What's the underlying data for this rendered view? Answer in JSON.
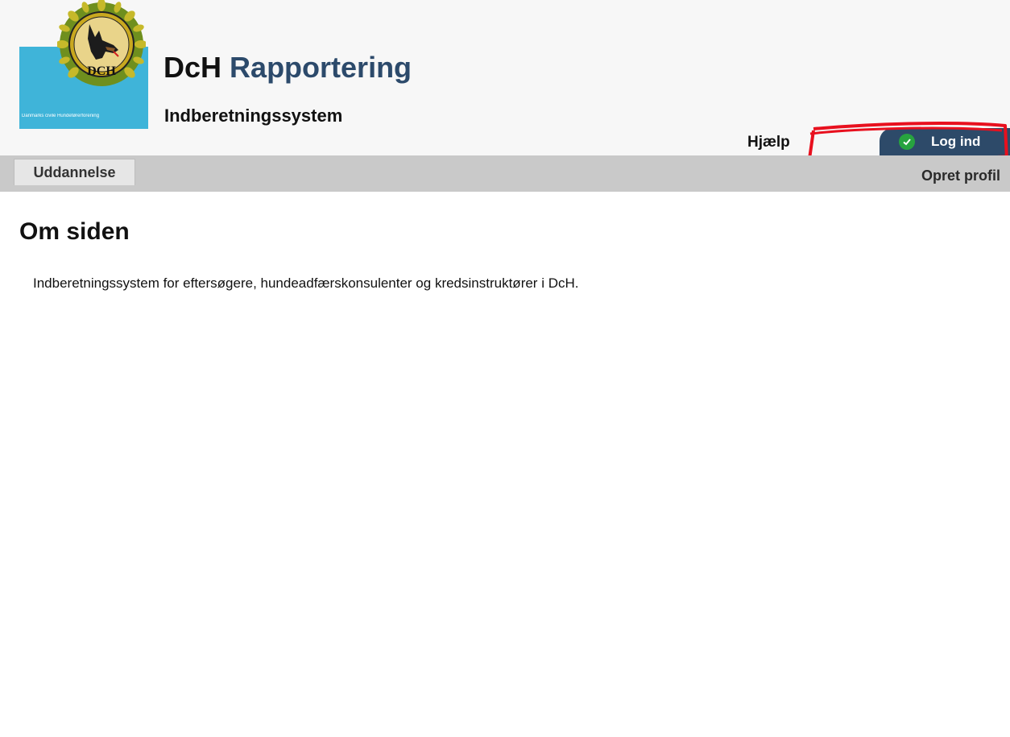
{
  "header": {
    "logo": {
      "icon": "dch-dog-emblem-icon",
      "emblem_text": "DCH",
      "org_text": "Danmarks civile Hundeførerforening"
    },
    "title_prefix": "DcH",
    "title_suffix": "Rapportering",
    "subtitle": "Indberetningssystem",
    "help_link": "Hjælp",
    "login_button": "Log ind",
    "login_icon": "check-circle-icon"
  },
  "nav": {
    "tabs": [
      {
        "label": "Uddannelse"
      }
    ],
    "create_profile": "Opret profil"
  },
  "main": {
    "title": "Om siden",
    "intro": "Indberetningssystem for eftersøgere, hundeadfærskonsulenter og kredsinstruktører i DcH."
  },
  "colors": {
    "header_bg": "#f7f7f7",
    "brand_blue": "#2c4a6b",
    "login_bg": "#2d4a69",
    "check_green": "#27a33f",
    "nav_bg": "#c9c9c9",
    "logo_bg": "#3fb4d9",
    "annotation_red": "#e8101e"
  }
}
